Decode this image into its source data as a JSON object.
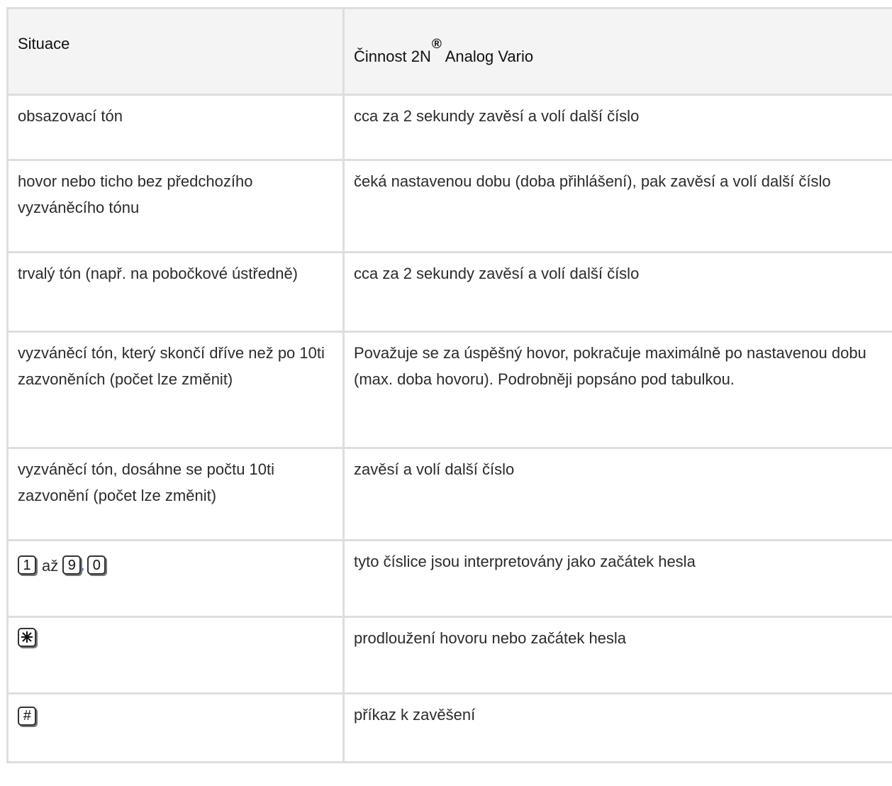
{
  "header": {
    "col1": "Situace",
    "col2": "Činnost 2N",
    "col2_sup": "®",
    "col2_tail": " Analog Vario"
  },
  "rows": [
    {
      "situation": "obsazovací tón",
      "action": "cca za 2 sekundy zavěsí a volí další číslo"
    },
    {
      "situation": "hovor nebo ticho bez předchozího vyzváněcího tónu",
      "action": "čeká nastavenou dobu (doba přihlášení), pak zavěsí a volí další číslo"
    },
    {
      "situation": "trvalý tón (např. na pobočkové ústředně)",
      "action": "cca za 2 sekundy zavěsí a volí další číslo"
    },
    {
      "situation": "vyzváněcí tón, který skončí dříve než po 10ti zazvoněních (počet lze změnit)",
      "action": "Považuje se za úspěšný hovor, pokračuje maximálně po nastavenou dobu (max. doba hovoru). Podrobněji popsáno pod tabulkou."
    },
    {
      "situation": "vyzváněcí tón, dosáhne se počtu 10ti zazvonění (počet lze změnit)",
      "action": "zavěsí a volí další číslo"
    },
    {
      "keys": {
        "first": "1",
        "joiner": "až",
        "second": "9",
        "sep": ",",
        "third": "0"
      },
      "action": "tyto číslice jsou interpretovány jako začátek hesla"
    },
    {
      "key_icon": "star-key-icon",
      "action": "prodloužení hovoru nebo začátek hesla"
    },
    {
      "key_icon": "hash-key-icon",
      "key_label": "#",
      "action": "příkaz k zavěšení"
    }
  ]
}
